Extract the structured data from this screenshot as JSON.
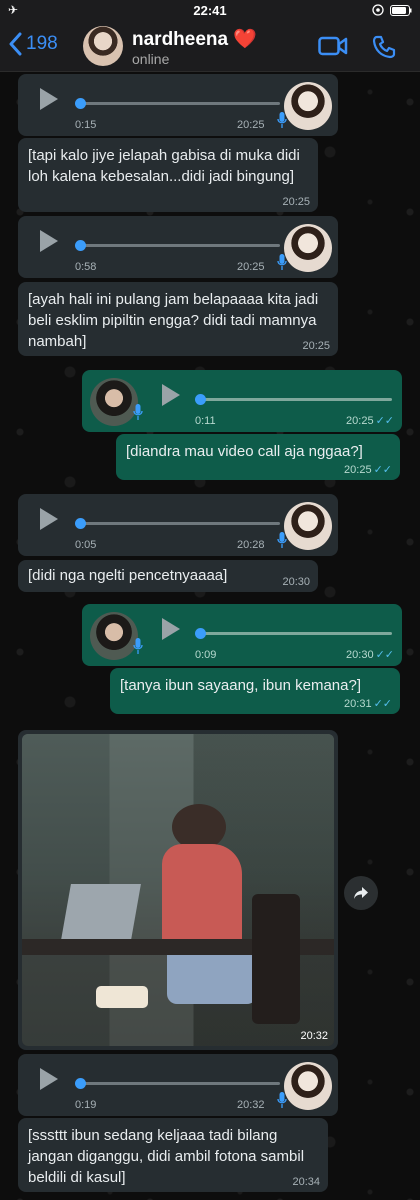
{
  "status": {
    "time": "22:41"
  },
  "header": {
    "back_count": "198",
    "name": "nardheena ❤️",
    "status": "online"
  },
  "messages": [
    {
      "kind": "voice",
      "dir": "in",
      "duration": "0:15",
      "time": "20:25"
    },
    {
      "kind": "text",
      "dir": "in",
      "text": "[tapi kalo jiye jelapah gabisa di muka didi loh kalena kebesalan...didi jadi bingung]",
      "time": "20:25"
    },
    {
      "kind": "voice",
      "dir": "in",
      "duration": "0:58",
      "time": "20:25"
    },
    {
      "kind": "text",
      "dir": "in",
      "text": "[ayah hali ini pulang jam belapaaaa kita jadi beli esklim pipiltin engga? didi tadi mamnya nambah]",
      "time": "20:25"
    },
    {
      "kind": "voice",
      "dir": "out",
      "duration": "0:11",
      "time": "20:25"
    },
    {
      "kind": "text",
      "dir": "out",
      "text": "[diandra mau video call aja nggaa?]",
      "time": "20:25"
    },
    {
      "kind": "voice",
      "dir": "in",
      "duration": "0:05",
      "time": "20:28"
    },
    {
      "kind": "text",
      "dir": "in",
      "text": "[didi nga ngelti pencetnyaaaa]",
      "time": "20:30"
    },
    {
      "kind": "voice",
      "dir": "out",
      "duration": "0:09",
      "time": "20:30"
    },
    {
      "kind": "text",
      "dir": "out",
      "text": "[tanya ibun sayaang, ibun kemana?]",
      "time": "20:31"
    },
    {
      "kind": "photo",
      "dir": "in",
      "time": "20:32"
    },
    {
      "kind": "voice",
      "dir": "in",
      "duration": "0:19",
      "time": "20:32"
    },
    {
      "kind": "text",
      "dir": "in",
      "text": "[sssttt ibun sedang keljaaa tadi bilang jangan diganggu, didi ambil fotona sambil beldili di kasul]",
      "time": "20:34"
    }
  ],
  "colors": {
    "accent": "#3b8ef5",
    "incoming": "#262d31",
    "outgoing": "#0e5c4a",
    "read_ticks": "#53bdeb"
  }
}
